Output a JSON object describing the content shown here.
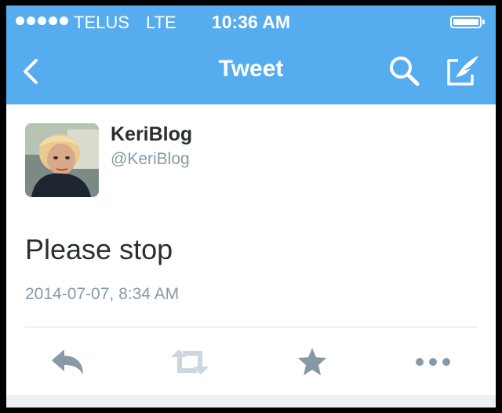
{
  "status_bar": {
    "carrier": "TELUS",
    "network": "LTE",
    "time": "10:36 AM",
    "signal_bars": 5,
    "battery_level": 1.0
  },
  "nav": {
    "title": "Tweet",
    "back_icon": "chevron-left-icon",
    "search_icon": "search-icon",
    "compose_icon": "compose-icon"
  },
  "tweet": {
    "display_name": "KeriBlog",
    "handle": "@KeriBlog",
    "text": "Please stop",
    "timestamp": "2014-07-07, 8:34 AM"
  },
  "actions": [
    {
      "icon": "reply-icon"
    },
    {
      "icon": "retweet-icon"
    },
    {
      "icon": "favorite-icon"
    },
    {
      "icon": "more-icon"
    }
  ],
  "colors": {
    "header": "#55acee",
    "text": "#292f33",
    "muted": "#8899a6",
    "action_icon": "#8899a6",
    "retweet_icon": "#ccd6dd"
  }
}
